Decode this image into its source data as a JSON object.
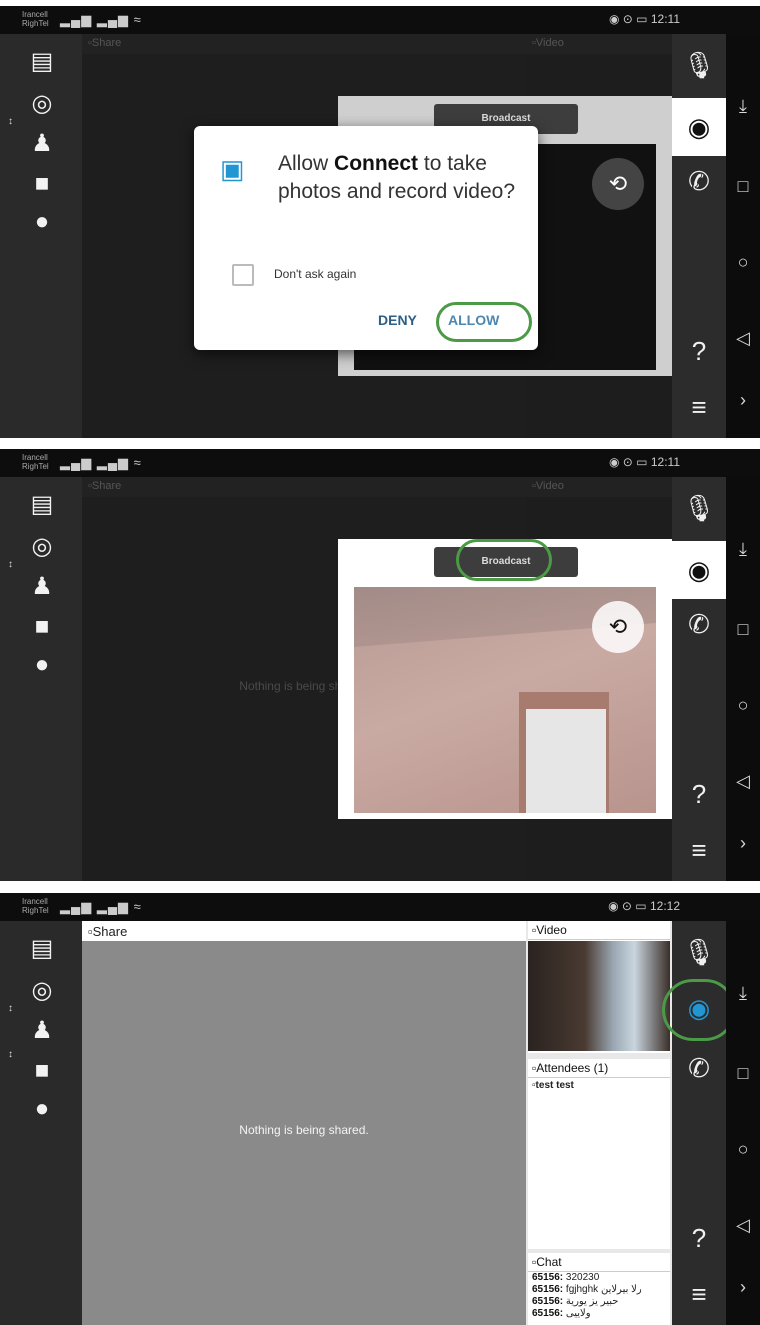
{
  "status": {
    "carrier": "Irancell RighTel",
    "signal": "▂▄▆ ▂▄▆ ≈",
    "time_p1": "12:11",
    "time_p2": "12:11",
    "time_p3": "12:12",
    "icons": "◉ ⊙ ▭"
  },
  "share": {
    "title": "Share",
    "nothing": "Nothing is being shared."
  },
  "video": {
    "title": "Video"
  },
  "attendees": {
    "title": "Attendees (1)",
    "items": [
      "test test"
    ]
  },
  "chat": {
    "title": "Chat",
    "lines": [
      {
        "user": "65156:",
        "text": "320230"
      },
      {
        "user": "65156:",
        "text": "fgjhghk رلا بیرلاین"
      },
      {
        "user": "65156:",
        "text": "حبیر یز یوریة"
      },
      {
        "user": "65156:",
        "text": "ولاییی"
      }
    ]
  },
  "popup": {
    "broadcast": "Broadcast"
  },
  "dialog": {
    "prefix": "Allow",
    "app": "Connect",
    "suffix": "to take photos and record video?",
    "checkbox": "Don't ask again",
    "deny": "DENY",
    "allow": "ALLOW"
  },
  "toolbar": {
    "help": "?"
  },
  "colors": {
    "highlight_ring": "#4b9a45",
    "accent": "#2196d3"
  }
}
